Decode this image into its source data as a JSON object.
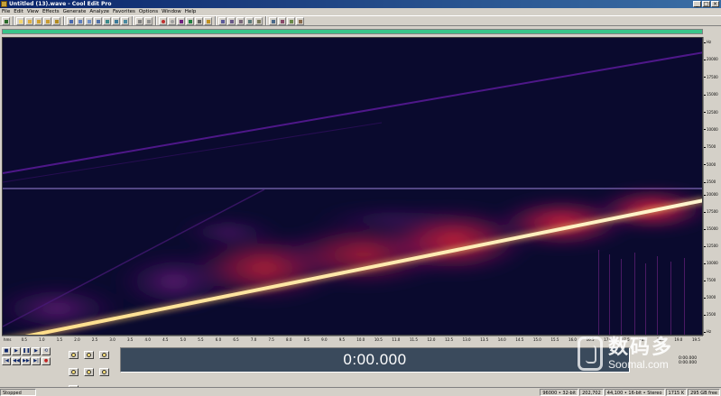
{
  "window": {
    "title": "Untitled (13).wave - Cool Edit Pro",
    "buttons": [
      "_",
      "□",
      "×"
    ]
  },
  "menu": [
    "File",
    "Edit",
    "View",
    "Effects",
    "Generate",
    "Analyze",
    "Favorites",
    "Options",
    "Window",
    "Help"
  ],
  "overview": {
    "position_fraction": 1.0,
    "color": "#3ac48a"
  },
  "spectral": {
    "view": "spectral",
    "channels": 2,
    "background": "#0a0a2e",
    "colors": {
      "low": "#3b0a6b",
      "mid": "#d11a4a",
      "hot": "#ff2b3b",
      "line": "#fff4c8"
    }
  },
  "freq_ruler": {
    "top_channel": [
      "Hz",
      "20000",
      "17500",
      "15000",
      "12500",
      "10000",
      "7500",
      "5000",
      "2500"
    ],
    "bottom_channel": [
      "20000",
      "17500",
      "15000",
      "12500",
      "10000",
      "7500",
      "5000",
      "2500",
      "Hz"
    ]
  },
  "time_ruler": [
    "hms",
    "0.5",
    "1.0",
    "1.5",
    "2.0",
    "2.5",
    "3.0",
    "3.5",
    "4.0",
    "4.5",
    "5.0",
    "5.5",
    "6.0",
    "6.5",
    "7.0",
    "7.5",
    "8.0",
    "8.5",
    "9.0",
    "9.5",
    "10.0",
    "10.5",
    "11.0",
    "11.5",
    "12.0",
    "12.5",
    "13.0",
    "13.5",
    "14.0",
    "14.5",
    "15.0",
    "15.5",
    "16.0",
    "16.5",
    "17.0",
    "17.5",
    "18.0",
    "18.5",
    "19.0",
    "19.5"
  ],
  "transport": {
    "row1": [
      "■",
      "▶",
      "❚❚",
      "▶",
      "⟲"
    ],
    "row2": [
      "|◀",
      "◀◀",
      "▶▶",
      "▶|",
      "●"
    ]
  },
  "time_display": "0:00.000",
  "selection_info": [
    "0:00.000",
    "0:00.000"
  ],
  "status": {
    "state": "Stopped",
    "items": [
      "96000 • 32-bit",
      "202,702",
      "44,100 • 16-bit • Stereo",
      "1715 K",
      "295 GB free"
    ]
  },
  "watermark": {
    "cn": "数码多",
    "en": "Soomal.com"
  }
}
